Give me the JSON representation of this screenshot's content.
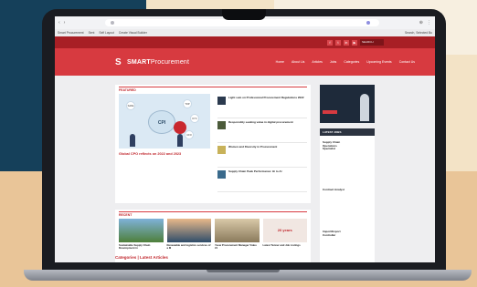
{
  "colors": {
    "brand_red": "#d73a40",
    "dark_red": "#a81f25",
    "navy_bg": "#15405a",
    "tan_bg": "#e9c598"
  },
  "browser": {
    "bookmarks": [
      "Smart Procurement",
      "Sent",
      "",
      "Self Layout",
      "Create Visual Builder"
    ],
    "bookmark_right": "Search, Selected Bu"
  },
  "social": {
    "icons": [
      "facebook-icon",
      "twitter-icon",
      "linkedin-icon",
      "youtube-icon"
    ],
    "search_label": "SEARCH"
  },
  "site": {
    "logo_text_1": "SMART",
    "logo_text_2": "Procurement",
    "nav": [
      "Home",
      "About Us",
      "Articles",
      "Jobs",
      "Categories",
      "Upcoming Events",
      "Contact Us"
    ]
  },
  "featured": {
    "heading": "FEATURED",
    "hero_label": "CPI",
    "hero_orbs": [
      "SAFE",
      "TOP",
      "KYC",
      "CFO"
    ],
    "title": "Global CPO reflects on 2022 and 2023",
    "side": [
      {
        "title": "Light sum on Professional Procurement Regulations 2022"
      },
      {
        "title": "Responsibly seeking value in digital procurement"
      },
      {
        "title": "Women and Diversity in Procurement"
      },
      {
        "title": "Supply Chain Peak Performance: Hi to Al"
      }
    ]
  },
  "recent": {
    "heading": "RECENT",
    "cards": [
      {
        "title": "Sustainable Supply Chain Development in"
      },
      {
        "title": "Renewable and logistics services of a M"
      },
      {
        "title": "Yeow Procurement Manager Video #1"
      },
      {
        "title": "Latest Tenner and Job Listings",
        "overlay": "20 years"
      }
    ]
  },
  "categories_title": "Categories | Latest Articles",
  "sidebar": {
    "jobs_heading": "LATEST JOBS",
    "jobs": [
      {
        "title": "Supply Chain Operations Specialist"
      },
      {
        "title": "Contract Analyst"
      },
      {
        "title": "Import/Export Controller"
      }
    ]
  }
}
